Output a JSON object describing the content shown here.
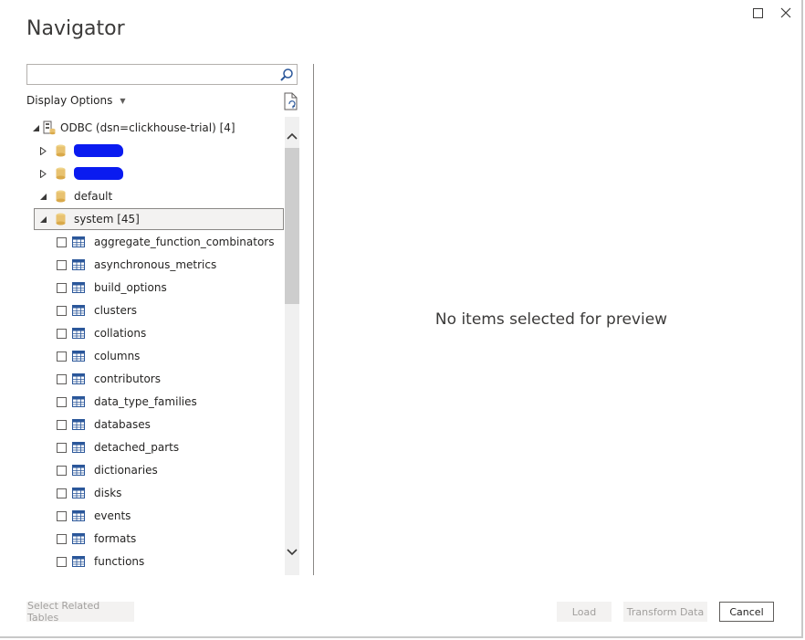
{
  "window": {
    "title": "Navigator",
    "maximize_icon": "square-icon",
    "close_icon": "x-icon"
  },
  "search": {
    "value": "",
    "placeholder": ""
  },
  "display_options": {
    "label": "Display Options"
  },
  "tree": {
    "root": {
      "label": "ODBC (dsn=clickhouse-trial) [4]"
    },
    "databases": [
      {
        "label": "",
        "redacted": true,
        "expanded": false
      },
      {
        "label": "",
        "redacted": true,
        "expanded": false
      },
      {
        "label": "default",
        "expanded": true
      },
      {
        "label": "system [45]",
        "expanded": true,
        "selected": true
      }
    ],
    "tables": [
      "aggregate_function_combinators",
      "asynchronous_metrics",
      "build_options",
      "clusters",
      "collations",
      "columns",
      "contributors",
      "data_type_families",
      "databases",
      "detached_parts",
      "dictionaries",
      "disks",
      "events",
      "formats",
      "functions"
    ]
  },
  "preview": {
    "message": "No items selected for preview"
  },
  "buttons": {
    "select_related": "Select Related Tables",
    "load": "Load",
    "transform": "Transform Data",
    "cancel": "Cancel"
  },
  "colors": {
    "accent": "#0a1bf0",
    "db_icon": "#e8c270",
    "table_icon": "#2b579a"
  }
}
